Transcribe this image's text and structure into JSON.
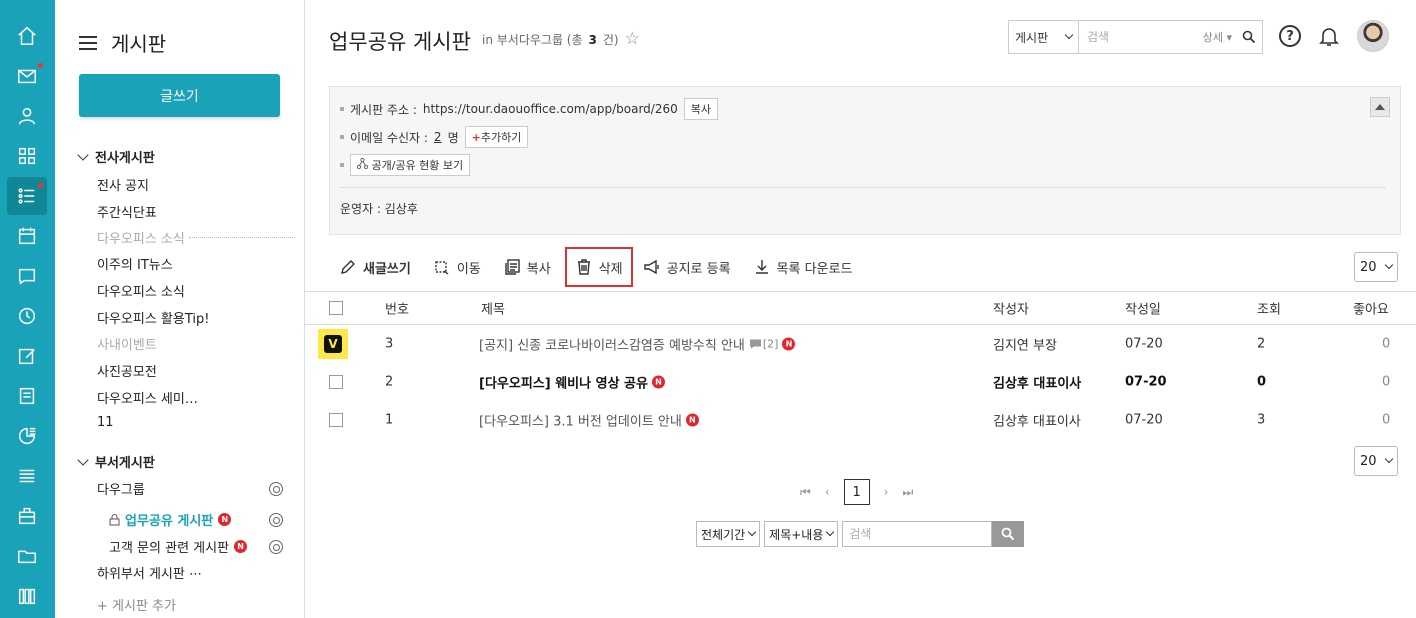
{
  "nav": {
    "title": "게시판",
    "write_label": "글쓰기",
    "group_company": "전사게시판",
    "company_items": [
      "전사 공지",
      "주간식단표"
    ],
    "sep1": "다우오피스 소식",
    "company_items2": [
      "이주의 IT뉴스",
      "다우오피스 소식",
      "다우오피스 활용Tip!"
    ],
    "sep2": "사내이벤트",
    "company_items3": [
      "사진공모전",
      "다우오피스 세미…",
      "11"
    ],
    "group_dept": "부서게시판",
    "dept_root": "다우그룹",
    "dept_board_active": "업무공유 게시판",
    "dept_board_2": "고객 문의 관련 게시판",
    "dept_sub": "하위부서 게시판 ⋯",
    "add_board": "+ 게시판 추가",
    "new_badge": "N"
  },
  "header": {
    "title": "업무공유 게시판",
    "meta_prefix": "in 부서다우그룹 (총",
    "meta_count": "3",
    "meta_suffix": "건)",
    "search_scope": "게시판",
    "search_placeholder": "검색",
    "search_detail": "상세 ▾",
    "help": "?"
  },
  "info": {
    "url_label": "게시판 주소 :",
    "url": "https://tour.daouoffice.com/app/board/260",
    "copy_label": "복사",
    "email_label": "이메일 수신자 :",
    "email_count": "2",
    "email_unit": "명",
    "add_label": "추가하기",
    "share_label": "공개/공유 현황 보기",
    "operator": "운영자 : 김상후"
  },
  "toolbar": {
    "new_post": "새글쓰기",
    "move": "이동",
    "copy": "복사",
    "delete": "삭제",
    "notice": "공지로 등록",
    "download": "목록 다운로드",
    "page_size": "20"
  },
  "table": {
    "headers": {
      "no": "번호",
      "subject": "제목",
      "author": "작성자",
      "date": "작성일",
      "views": "조회",
      "likes": "좋아요"
    },
    "rows": [
      {
        "no": "3",
        "subject": "[공지] 신종 코로나바이러스감염증 예방수칙 안내",
        "comments": "[2]",
        "author": "김지연 부장",
        "date": "07-20",
        "views": "2",
        "likes": "0",
        "checkmark": "V"
      },
      {
        "no": "2",
        "subject": "[다우오피스] 웨비나 영상 공유",
        "author": "김상후 대표이사",
        "date": "07-20",
        "views": "0",
        "likes": "0"
      },
      {
        "no": "1",
        "subject": "[다우오피스] 3.1 버전 업데이트 안내",
        "author": "김상후 대표이사",
        "date": "07-20",
        "views": "3",
        "likes": "0"
      }
    ]
  },
  "pager": {
    "current": "1"
  },
  "bottom_search": {
    "period": "전체기간",
    "field": "제목+내용",
    "placeholder": "검색"
  },
  "colors": {
    "accent": "#1aa3b8",
    "delete_outline": "#e03131",
    "highlight": "#fbe84a"
  }
}
